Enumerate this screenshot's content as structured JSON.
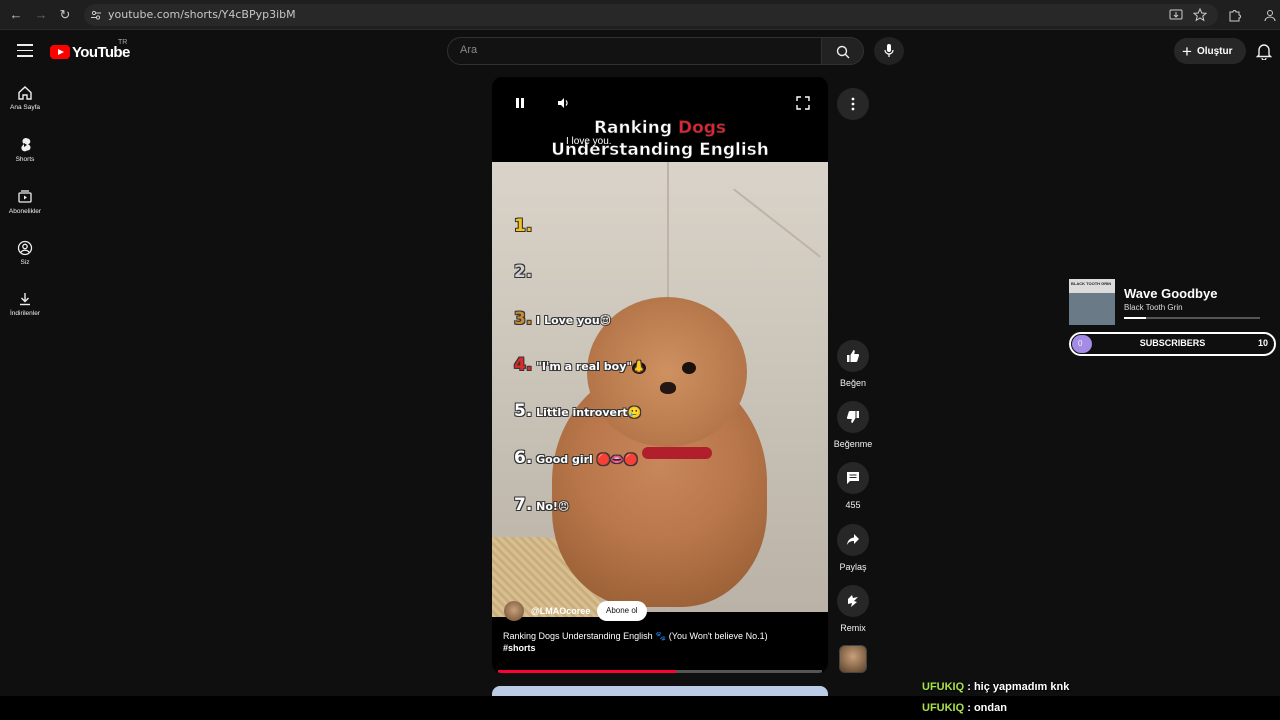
{
  "browser": {
    "url": "youtube.com/shorts/Y4cBPyp3ibM"
  },
  "header": {
    "logo_text": "YouTube",
    "country_code": "TR",
    "search_placeholder": "Ara",
    "create_label": "Oluştur"
  },
  "sidebar": {
    "items": [
      {
        "label": "Ana Sayfa",
        "icon": "home-icon"
      },
      {
        "label": "Shorts",
        "icon": "shorts-icon"
      },
      {
        "label": "Abonelikler",
        "icon": "subscriptions-icon"
      },
      {
        "label": "Siz",
        "icon": "user-icon"
      },
      {
        "label": "İndirilenler",
        "icon": "download-icon"
      }
    ]
  },
  "video": {
    "overlay_title_1": "Ranking",
    "overlay_title_1_red": "Dogs",
    "overlay_title_2": "Understanding English",
    "floating_caption": "I love you.",
    "ranks": [
      {
        "num": "1.",
        "text": ""
      },
      {
        "num": "2.",
        "text": ""
      },
      {
        "num": "3.",
        "text": "I Love you😌"
      },
      {
        "num": "4.",
        "text": "\"I'm a real boy\"👃"
      },
      {
        "num": "5.",
        "text": "Little introvert🥲"
      },
      {
        "num": "6.",
        "text": "Good girl 🔴👄🔴"
      },
      {
        "num": "7.",
        "text": "No!😠"
      }
    ],
    "channel": "@LMAOcoree",
    "subscribe_label": "Abone ol",
    "title": "Ranking Dogs Understanding English 🐾 (You Won't believe No.1)",
    "hashtag": "#shorts",
    "progress": 0.55,
    "accent_color": "#ff0033"
  },
  "actions": {
    "like": "Beğen",
    "dislike": "Beğenme",
    "comments": "455",
    "share": "Paylaş",
    "remix": "Remix"
  },
  "overlay": {
    "song_title": "Wave Goodbye",
    "artist": "Black Tooth Grin",
    "album_text": "BLACK TOOTH GRIN",
    "song_progress": 0.16,
    "subscribers_label": "SUBSCRIBERS",
    "subscribers_current": "0",
    "subscribers_goal": "10",
    "chat": [
      {
        "user": "UFUKIQ",
        "message": " : hiç yapmadım knk"
      },
      {
        "user": "UFUKIQ",
        "message": " : ondan"
      }
    ]
  }
}
